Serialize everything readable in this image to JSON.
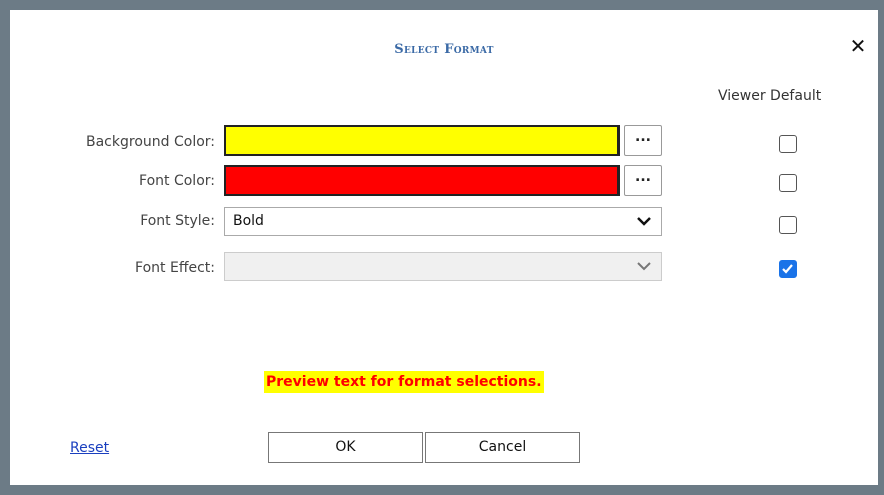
{
  "dialog": {
    "title": "Select Format",
    "close_label": "✕",
    "viewer_default_header": "Viewer Default"
  },
  "rows": [
    {
      "label": "Background Color:",
      "kind": "color",
      "color": "#ffff00",
      "picker_label": "...",
      "viewer_default": false
    },
    {
      "label": "Font Color:",
      "kind": "color",
      "color": "#ff0000",
      "picker_label": "...",
      "viewer_default": false
    },
    {
      "label": "Font Style:",
      "kind": "select",
      "value": "Bold",
      "disabled": false,
      "viewer_default": false
    },
    {
      "label": "Font Effect:",
      "kind": "select",
      "value": "",
      "disabled": true,
      "viewer_default": true
    }
  ],
  "preview": {
    "text": "Preview text for format selections.",
    "background": "#ffff00",
    "color": "#ff0000"
  },
  "footer": {
    "reset_label": "Reset",
    "ok_label": "OK",
    "cancel_label": "Cancel"
  }
}
